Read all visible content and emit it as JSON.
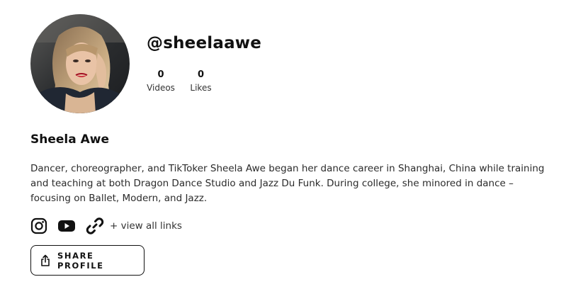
{
  "profile": {
    "handle": "@sheelaawe",
    "avatar_icon": "profile-photo",
    "stats": {
      "videos_count": "0",
      "videos_label": "Videos",
      "likes_count": "0",
      "likes_label": "Likes"
    },
    "name": "Sheela Awe",
    "bio": "Dancer, choreographer, and TikToker Sheela Awe began her dance career in Shanghai, China while training and teaching at both Dragon Dance Studio and Jazz Du Funk. During college, she minored in dance – focusing on Ballet, Modern, and Jazz."
  },
  "links": {
    "icons": [
      "instagram-icon",
      "youtube-icon",
      "link-icon"
    ],
    "view_all_label": "+ view all links"
  },
  "actions": {
    "share_label": "SHARE PROFILE",
    "share_icon": "share-icon"
  },
  "colors": {
    "text": "#111111",
    "background": "#ffffff"
  }
}
